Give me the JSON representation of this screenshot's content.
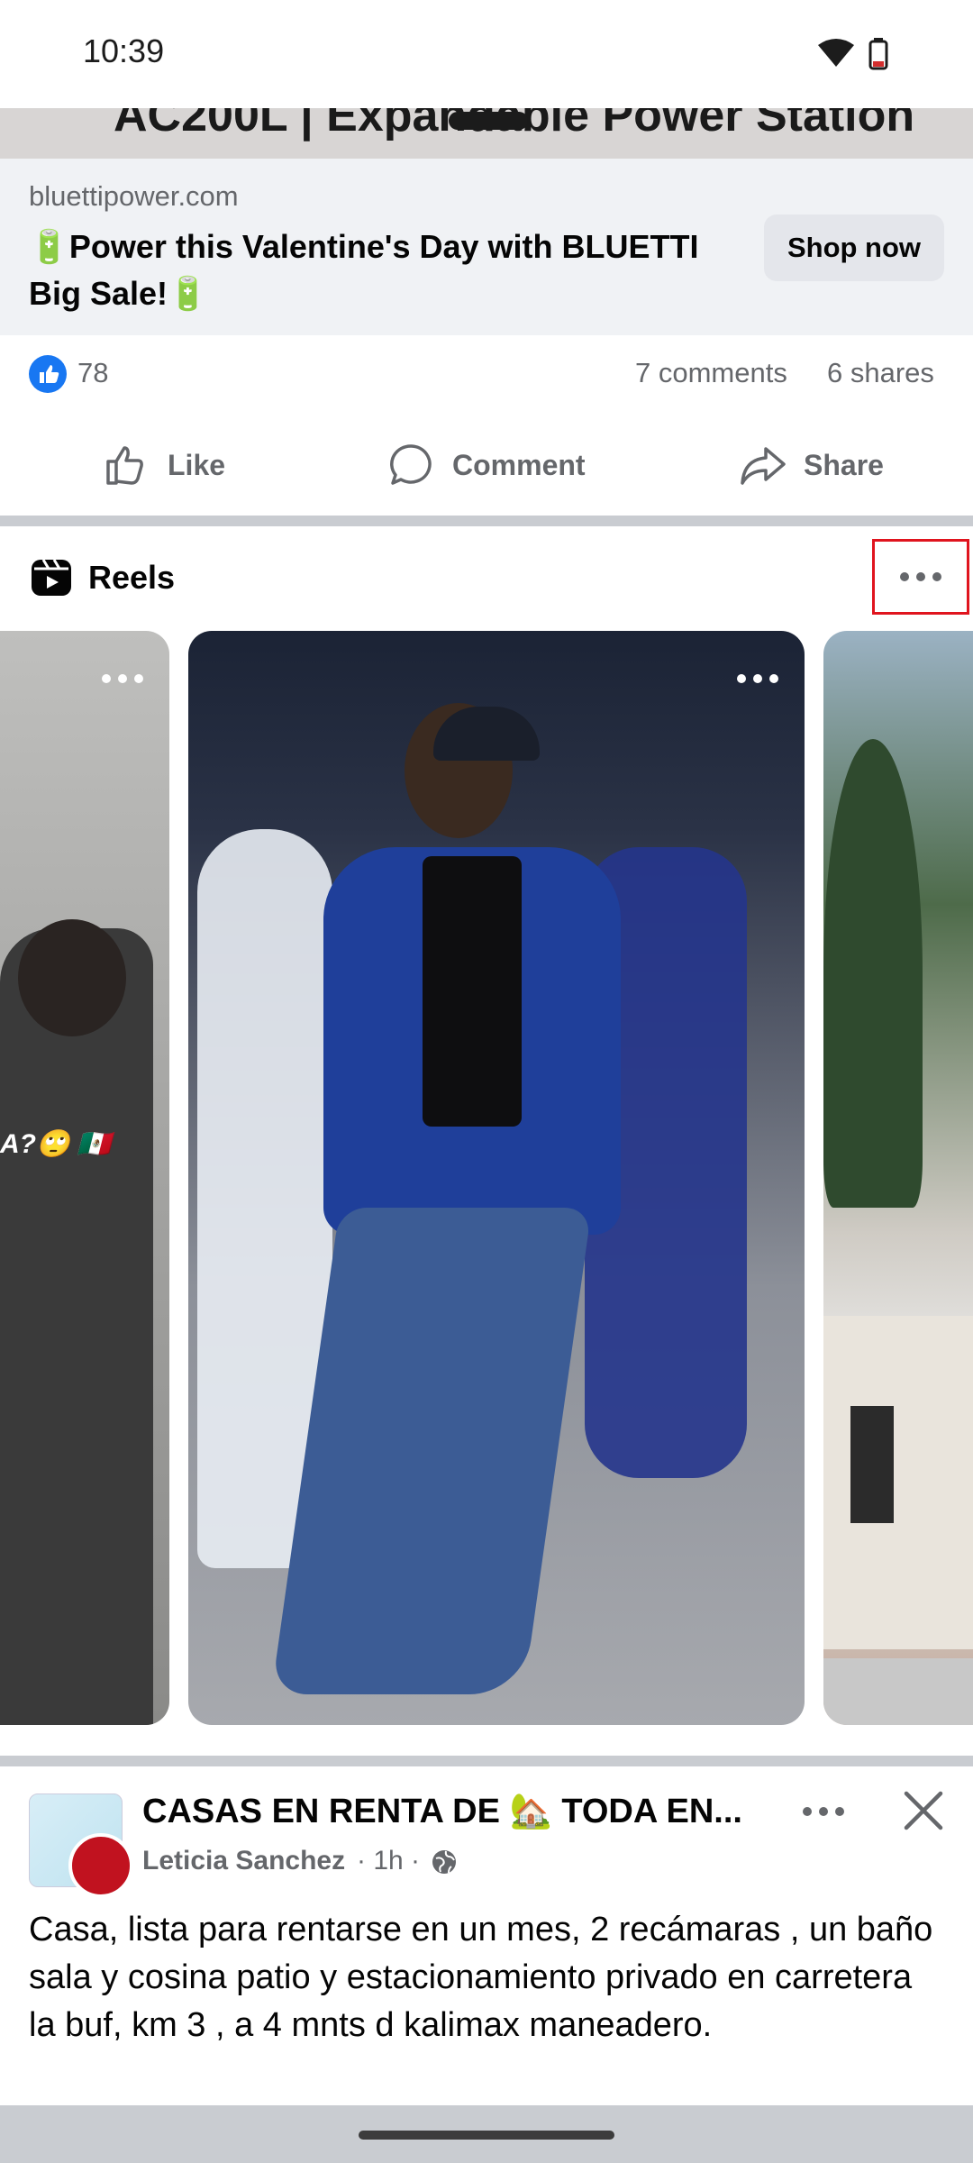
{
  "status_bar": {
    "time": "10:39"
  },
  "video_strip": {
    "text": "AC200L | Expandable Power Station"
  },
  "ad": {
    "domain": "bluettipower.com",
    "headline": "🔋Power this Valentine's Day with BLUETTI Big Sale!🔋",
    "cta_label": "Shop now"
  },
  "engagement": {
    "likes": "78",
    "comments": "7 comments",
    "shares": "6 shares"
  },
  "actions": {
    "like": "Like",
    "comment": "Comment",
    "share": "Share"
  },
  "reels": {
    "title": "Reels",
    "left_caption": "A?🙄 🇲🇽"
  },
  "post": {
    "title": "CASAS EN RENTA DE 🏡 TODA EN...",
    "author": "Leticia Sanchez",
    "time": "· 1h ·",
    "text": "Casa,  lista  para rentarse en un mes, 2 recámaras , un baño sala y cosina  patio y estacionamiento  privado en carretera la buf, km  3 ,   a  4 mnts    d kalimax maneadero."
  },
  "colors": {
    "accent": "#1877f2",
    "highlight_box": "#e0141e",
    "secondary_text": "#65676b"
  }
}
